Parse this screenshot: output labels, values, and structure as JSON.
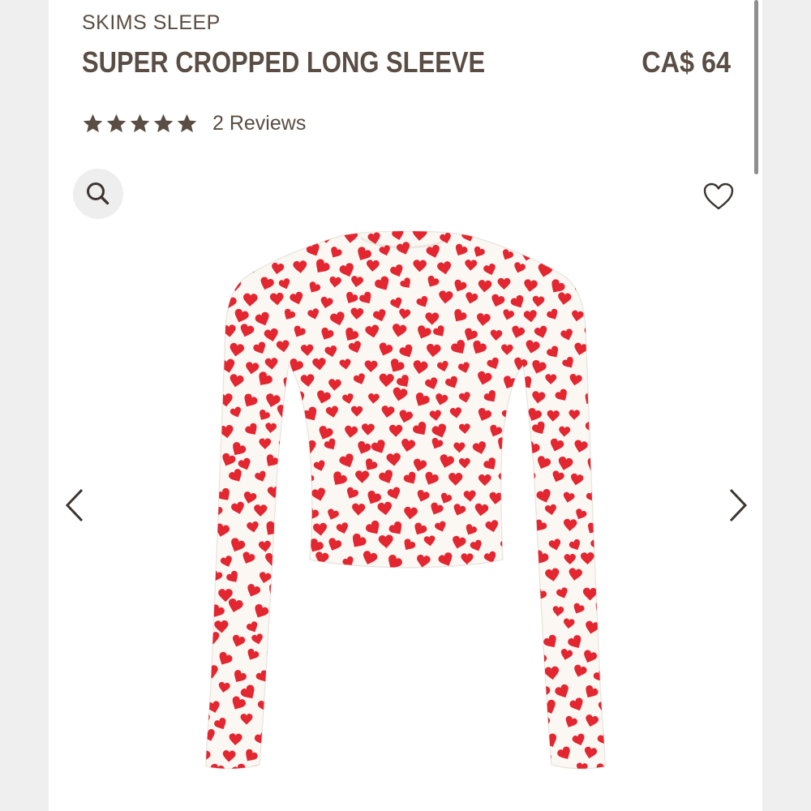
{
  "product": {
    "brand": "SKIMS SLEEP",
    "title": "SUPER CROPPED LONG SLEEVE",
    "price": "CA$ 64",
    "rating": 5,
    "reviews_label": "2 Reviews"
  },
  "icons": {
    "search": "search-icon",
    "favorite": "heart-outline-icon",
    "previous": "chevron-left-icon",
    "next": "chevron-right-icon",
    "star": "star-icon"
  },
  "colors": {
    "text": "#5a4d43",
    "garment": "#fbf8f4",
    "print": "#e3262f"
  }
}
